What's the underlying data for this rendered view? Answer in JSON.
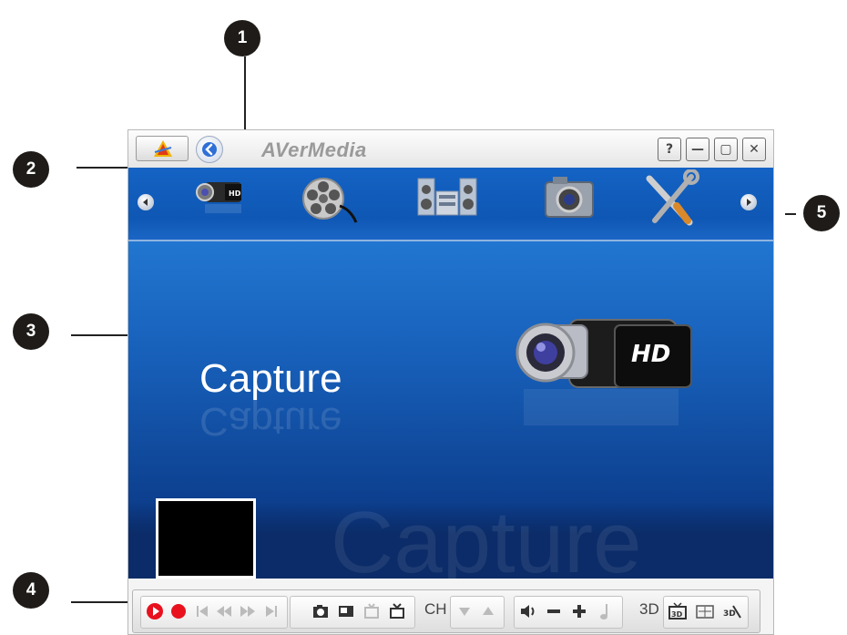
{
  "callouts": [
    "1",
    "2",
    "3",
    "4",
    "5"
  ],
  "titlebar": {
    "brand": "AVerMedia",
    "help": "?",
    "minimize": "—",
    "maximize": "▢",
    "close": "✕"
  },
  "menu": {
    "items": [
      "capture-hd-camcorder",
      "film-reel",
      "stereo-speakers",
      "camera",
      "tools"
    ]
  },
  "main": {
    "title": "Capture",
    "watermark": "Capture",
    "camera_badge": "HD"
  },
  "toolbar": {
    "ch_label": "CH",
    "label_3d": "3D"
  },
  "colors": {
    "accent_blue": "#1463c4",
    "record_red": "#e8111d"
  }
}
